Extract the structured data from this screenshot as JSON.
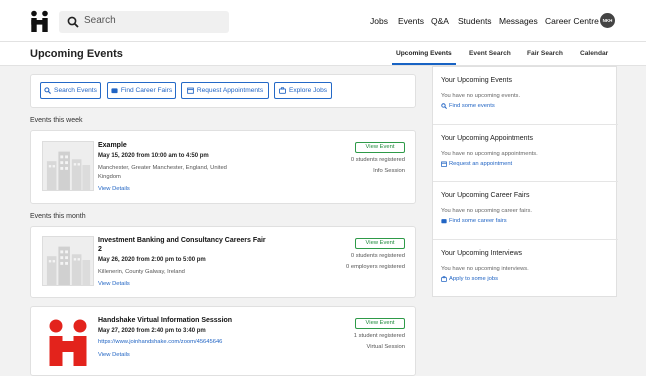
{
  "topbar": {
    "search_placeholder": "Search",
    "nav": [
      "Jobs",
      "Events",
      "Q&A",
      "Students",
      "Messages",
      "Career Centre"
    ],
    "avatar": "NKH"
  },
  "subbar": {
    "title": "Upcoming Events",
    "tabs": [
      "Upcoming Events",
      "Event Search",
      "Fair Search",
      "Calendar"
    ]
  },
  "actions": [
    "Search Events",
    "Find Career Fairs",
    "Request Appointments",
    "Explore Jobs"
  ],
  "sections": {
    "week": "Events this week",
    "month": "Events this month"
  },
  "events": [
    {
      "title": "Example",
      "date": "May 15, 2020 from 10:00 am to 4:50 pm",
      "loc1": "Manchester, Greater Manchester, England, United",
      "loc2": "Kingdom",
      "link": "View Details",
      "btn": "View Event",
      "meta1": "0 students registered",
      "meta2": "Info Session"
    },
    {
      "title": "Investment Banking and Consultancy Careers Fair",
      "title2": "2",
      "date": "May 26, 2020 from 2:00 pm to 5:00 pm",
      "loc1": "Killenerin, County Galway, Ireland",
      "link": "View Details",
      "btn": "View Event",
      "meta1": "0 students registered",
      "meta2": "0 employers registered"
    },
    {
      "title": "Handshake Virtual Information Sesssion",
      "date": "May 27, 2020 from 2:40 pm to 3:40 pm",
      "loc1": "https://www.joinhandshake.com/zoom/45645646",
      "link": "View Details",
      "btn": "View Event",
      "meta1": "1 student registered",
      "meta2": "Virtual Session"
    }
  ],
  "sidebar": [
    {
      "heading": "Your Upcoming Events",
      "text": "You have no upcoming events.",
      "link": "Find some events"
    },
    {
      "heading": "Your Upcoming Appointments",
      "text": "You have no upcoming appointments.",
      "link": "Request an appointment"
    },
    {
      "heading": "Your Upcoming Career Fairs",
      "text": "You have no upcoming career fairs.",
      "link": "Find some career fairs"
    },
    {
      "heading": "Your Upcoming Interviews",
      "text": "You have no upcoming interviews.",
      "link": "Apply to some jobs"
    }
  ],
  "colors": {
    "accent": "#1863c4",
    "green": "#2e9a48",
    "brand_red": "#e3231c"
  }
}
